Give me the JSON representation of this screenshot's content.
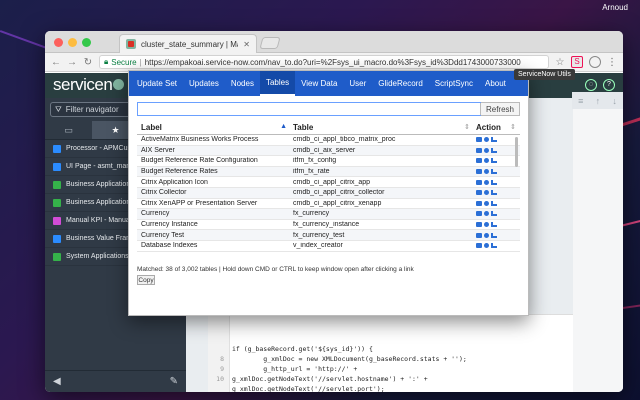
{
  "os": {
    "user": "Arnoud"
  },
  "browser": {
    "tab_title": "cluster_state_summary | Macro",
    "secure_label": "Secure",
    "url": "https://empakoai.service-now.com/nav_to.do?uri=%2Fsys_ui_macro.do%3Fsys_id%3Ddd1743000733000",
    "extension_tooltip": "ServiceNow Utils"
  },
  "servicenow": {
    "logo": "servicen",
    "filter_placeholder": "Filter navigator",
    "nav_items": [
      {
        "label": "Processor - APMCusto",
        "color": "#2b8cff"
      },
      {
        "label": "UI Page - asmt_manag",
        "color": "#2b8cff"
      },
      {
        "label": "Business Application -",
        "color": "#35b24a"
      },
      {
        "label": "Business Applications",
        "color": "#35b24a"
      },
      {
        "label": "Manual KPI - Manual K",
        "color": "#d24cd6"
      },
      {
        "label": "Business Value Framew",
        "color": "#2b8cff"
      },
      {
        "label": "System Applications -",
        "color": "#35b24a"
      }
    ],
    "code_lines": [
      {
        "num": "",
        "text": "if (g_baseRecord.get('${sys_id}')) {"
      },
      {
        "num": "8",
        "text": "        g_xmlDoc = new XMLDocument(g_baseRecord.stats + '');"
      },
      {
        "num": "9",
        "text": "        g_http_url = 'http://' +"
      },
      {
        "num": "10",
        "text": "g_xmlDoc.getNodeText('//servlet.hostname') + ':' +"
      },
      {
        "num": "",
        "text": "g_xmlDoc.getNodeText('//servlet.port');"
      }
    ]
  },
  "popup": {
    "tabs": [
      "Update Set",
      "Updates",
      "Nodes",
      "Tables",
      "View Data",
      "User",
      "GlideRecord",
      "ScriptSync",
      "About"
    ],
    "active_tab": "Tables",
    "search_value": "",
    "refresh_label": "Refresh",
    "columns": {
      "label": "Label",
      "table": "Table",
      "action": "Action"
    },
    "rows": [
      {
        "label": "ActiveMatrix Business Works Process",
        "table": "cmdb_ci_appl_tibco_matrix_proc"
      },
      {
        "label": "AIX Server",
        "table": "cmdb_ci_aix_server"
      },
      {
        "label": "Budget Reference Rate Configuration",
        "table": "itfm_fx_config"
      },
      {
        "label": "Budget Reference Rates",
        "table": "itfm_fx_rate"
      },
      {
        "label": "Citrix Application Icon",
        "table": "cmdb_ci_appl_citrix_app"
      },
      {
        "label": "Citrix Collector",
        "table": "cmdb_ci_appl_citrix_collector"
      },
      {
        "label": "Citrix XenAPP or Presentation Server",
        "table": "cmdb_ci_appl_citrix_xenapp"
      },
      {
        "label": "Currency",
        "table": "fx_currency"
      },
      {
        "label": "Currency Instance",
        "table": "fx_currency_instance"
      },
      {
        "label": "Currency Test",
        "table": "fx_currency_test"
      },
      {
        "label": "Database Indexes",
        "table": "v_index_creator"
      }
    ],
    "status": "Matched: 38 of 3,002 tables | Hold down CMD or CTRL to keep window open after clicking a link",
    "copy_label": "Copy"
  }
}
